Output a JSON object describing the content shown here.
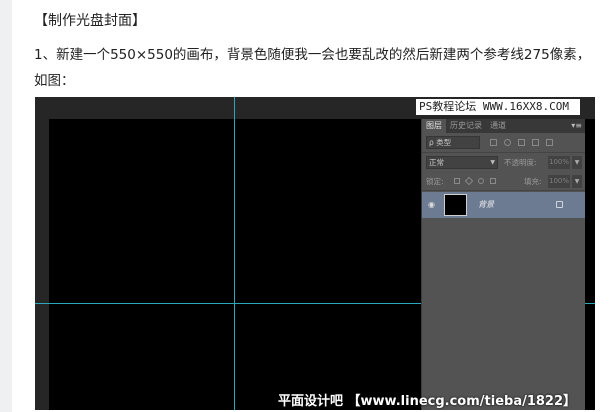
{
  "article": {
    "title": "【制作光盘封面】",
    "paragraph": "1、新建一个550×550的画布，背景色随便我一会也要乱改的然后新建两个参考线275像素，如图："
  },
  "screenshot": {
    "site_watermark": "PS教程论坛 WWW.16XX8.COM",
    "bottom_watermark": "平面设计吧 【www.linecg.com/tieba/1822】",
    "colors": {
      "guide": "#2aa7b8",
      "canvas": "#000000",
      "panel": "#535353",
      "selected_layer": "#6d7b92"
    },
    "panel": {
      "tabs": [
        "图层",
        "历史记录",
        "通道"
      ],
      "menu_icon": "panel-menu-icon",
      "filter_kind": "ρ 类型",
      "blend_mode": "正常",
      "opacity_label": "不透明度:",
      "opacity_value": "100%",
      "lock_label": "锁定:",
      "fill_label": "填充:",
      "fill_value": "100%",
      "layers": [
        {
          "name": "背景",
          "visible": true,
          "locked": true
        }
      ]
    }
  }
}
